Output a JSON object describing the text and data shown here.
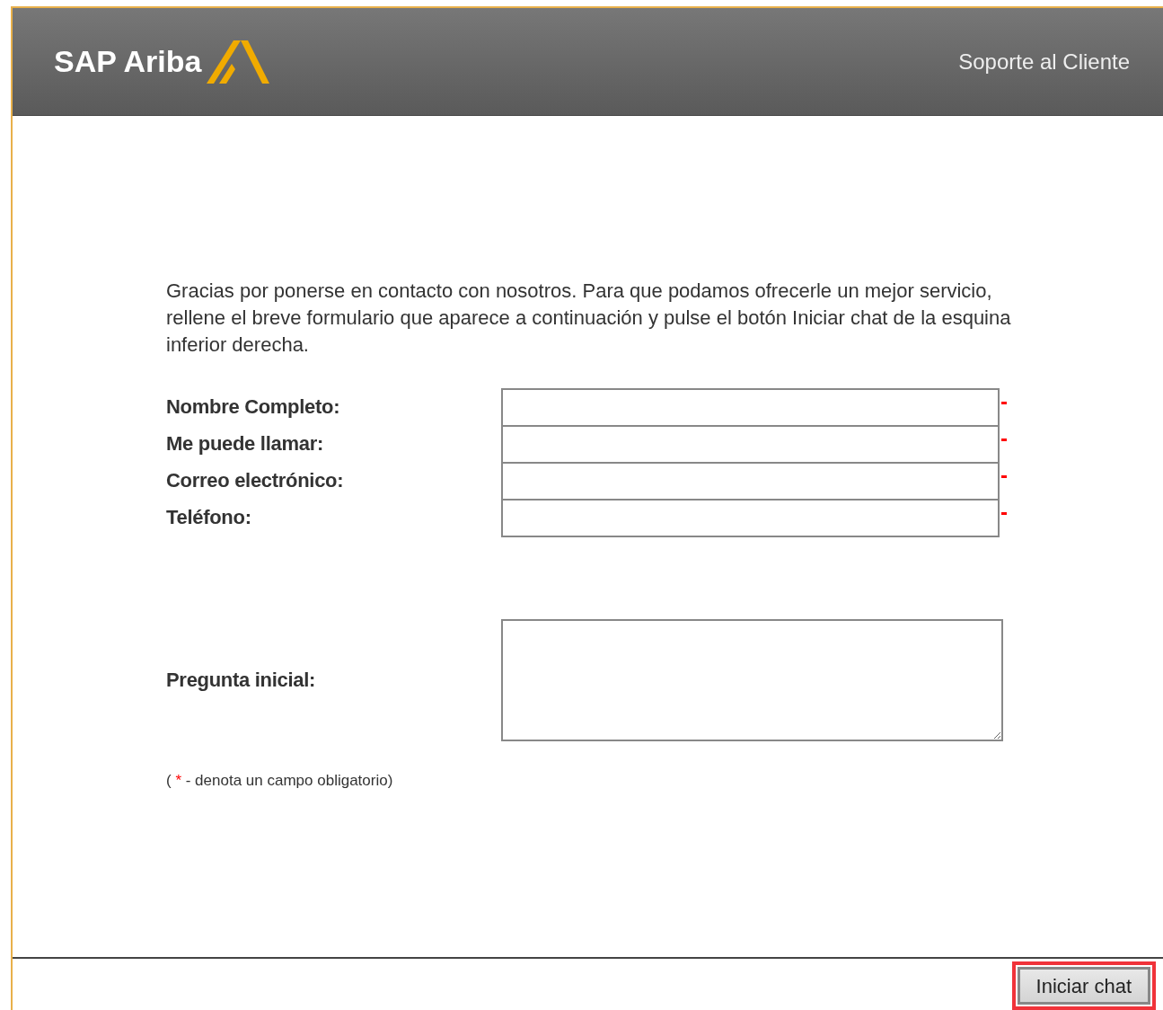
{
  "header": {
    "brand": "SAP Ariba",
    "link": "Soporte al Cliente"
  },
  "intro": "Gracias por ponerse en contacto con nosotros. Para que podamos ofrecerle un mejor servicio, rellene el breve formulario que aparece a continuación y pulse el botón Iniciar chat de la esquina inferior derecha.",
  "fields": [
    {
      "label": "Nombre Completo:",
      "required": true
    },
    {
      "label": "Me puede llamar:",
      "required": true
    },
    {
      "label": "Correo electrónico:",
      "required": true
    },
    {
      "label": "Teléfono:",
      "required": true
    }
  ],
  "question": {
    "label": "Pregunta inicial:"
  },
  "note": {
    "open": "(",
    "mark": "*",
    "rest": "- denota un campo obligatorio)"
  },
  "button": {
    "label": "Iniciar chat",
    "highlighted": true
  }
}
